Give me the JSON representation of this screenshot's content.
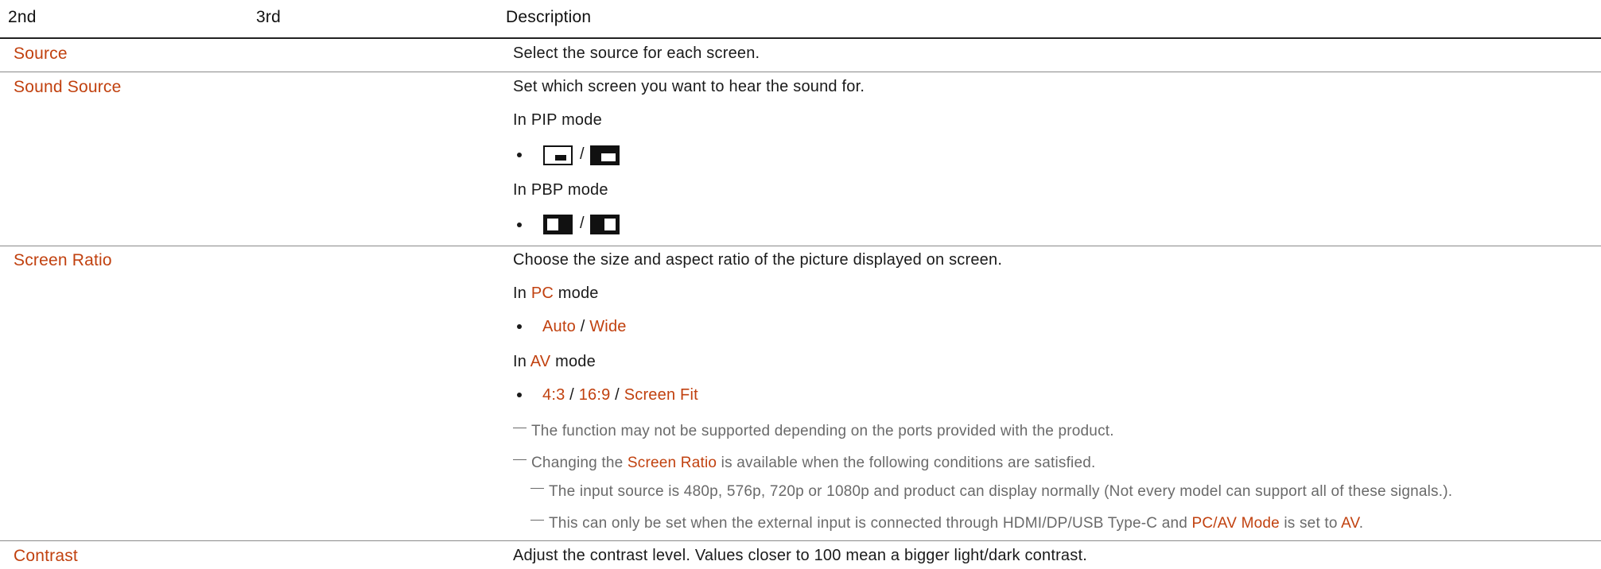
{
  "header": {
    "col2": "2nd",
    "col3": "3rd",
    "col_desc": "Description"
  },
  "source": {
    "label": "Source",
    "desc": "Select the source for each screen."
  },
  "sound_source": {
    "label": "Sound Source",
    "desc": "Set which screen you want to hear the sound for.",
    "pip_mode": "In PIP mode",
    "pbp_mode": "In PBP mode",
    "sep": "/"
  },
  "screen_ratio": {
    "label": "Screen Ratio",
    "desc": "Choose the size and aspect ratio of the picture displayed on screen.",
    "pc_pre": "In ",
    "pc": "PC",
    "pc_post": " mode",
    "pc_opt1": "Auto",
    "pc_opt2": "Wide",
    "av_pre": "In ",
    "av": "AV",
    "av_post": " mode",
    "av_opt1": "4:3",
    "av_opt2": "16:9",
    "av_opt3": "Screen Fit",
    "sep": " / ",
    "note1": "The function may not be supported depending on the ports provided with the product.",
    "note2_pre": "Changing the ",
    "note2_acc": "Screen Ratio",
    "note2_post": " is available when the following conditions are satisfied.",
    "note3": "The input source is 480p, 576p, 720p or 1080p and product can display normally (Not every model can support all of these signals.).",
    "note4_pre": "This can only be set when the external input is connected through HDMI/DP/USB Type-C and ",
    "note4_acc1": "PC/AV Mode",
    "note4_mid": " is set to ",
    "note4_acc2": "AV",
    "note4_post": "."
  },
  "contrast": {
    "label": "Contrast",
    "desc": "Adjust the contrast level. Values closer to 100 mean a bigger light/dark contrast."
  },
  "colors": {
    "accent": "#c1410f",
    "text": "#1a1a1a",
    "note": "#6a6a6a",
    "rule": "#8a8a8a"
  },
  "icons": [
    "pip-small-window-icon",
    "pip-large-window-icon",
    "pbp-left-active-icon",
    "pbp-right-active-icon"
  ]
}
